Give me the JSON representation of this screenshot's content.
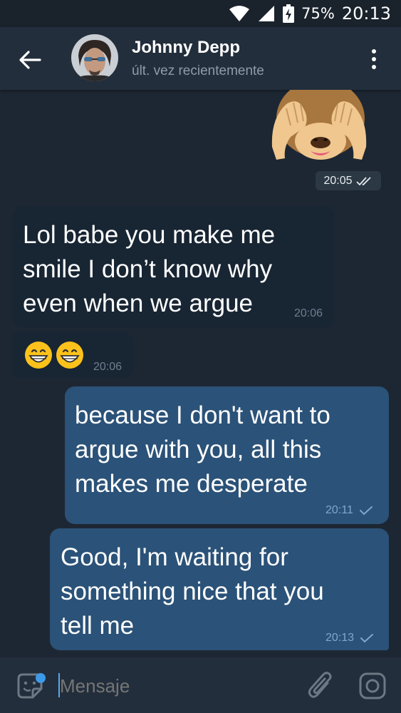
{
  "status_bar": {
    "battery": "75%",
    "time": "20:13"
  },
  "header": {
    "contact_name": "Johnny Depp",
    "contact_status": "últ. vez recientemente"
  },
  "messages": [
    {
      "type": "sticker",
      "direction": "out",
      "sticker": "see-no-evil-monkey",
      "time": "20:05",
      "status": "read"
    },
    {
      "type": "text",
      "direction": "in",
      "lines": [
        "Lol babe you make me",
        "smile I don’t know why",
        "even when we argue"
      ],
      "time": "20:06"
    },
    {
      "type": "emoji",
      "direction": "in",
      "emojis": [
        "grinning-face-with-smiling-eyes",
        "grinning-face-with-smiling-eyes"
      ],
      "time": "20:06"
    },
    {
      "type": "text",
      "direction": "out",
      "lines": [
        "because I don't want to",
        "argue with you, all this",
        "makes me desperate"
      ],
      "time": "20:11",
      "status": "sent"
    },
    {
      "type": "text",
      "direction": "out",
      "lines": [
        "Good, I'm waiting for",
        "something nice that you",
        "tell me"
      ],
      "time": "20:13",
      "status": "sent"
    }
  ],
  "composer": {
    "placeholder": "Mensaje"
  },
  "colors": {
    "background": "#1d2733",
    "header": "#232e3c",
    "incoming_bubble": "#182533",
    "outgoing_bubble": "#2b5278",
    "accent": "#5aa6e6"
  }
}
